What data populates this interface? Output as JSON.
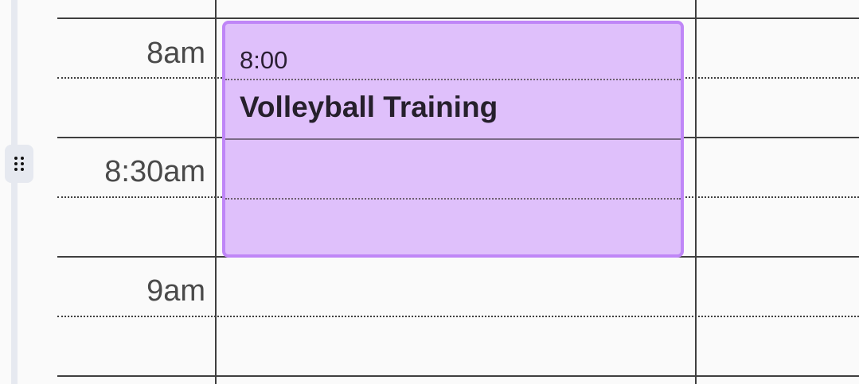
{
  "time_slots": [
    "8am",
    "8:30am",
    "9am"
  ],
  "event": {
    "time": "8:00",
    "title": "Volleyball Training",
    "color": "#dfc0fb",
    "border_color": "#bf86f7"
  },
  "drag_handle": {
    "icon": "drag-handle-icon"
  }
}
